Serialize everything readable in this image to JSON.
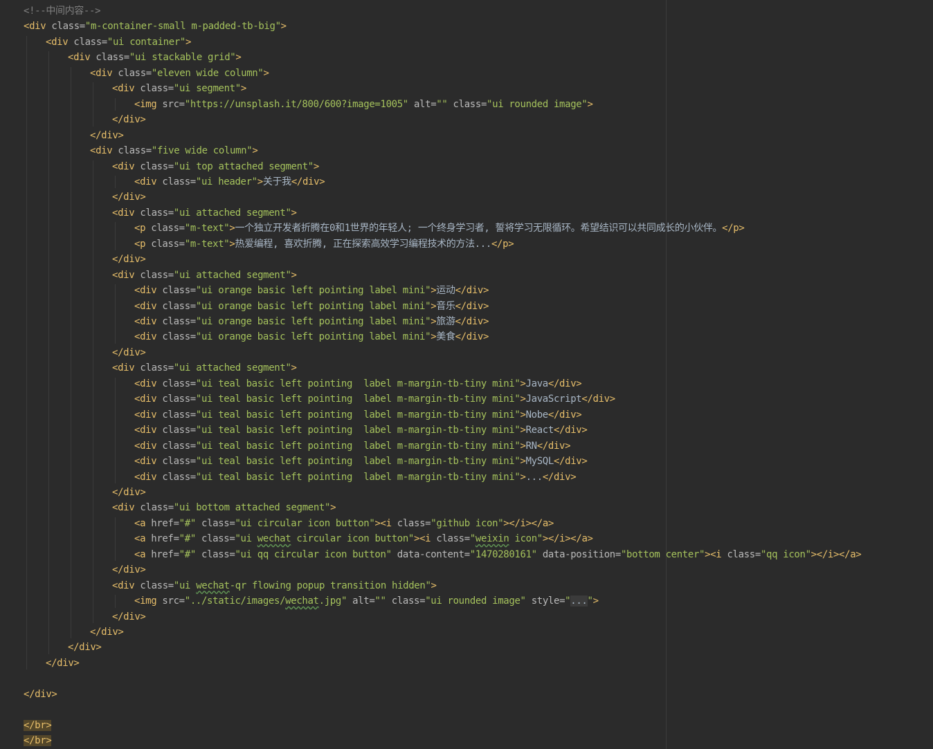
{
  "editor": {
    "language": "html",
    "colors": {
      "background": "#2b2b2b",
      "tag": "#e8bf6a",
      "attribute": "#bababa",
      "value": "#a5c25c",
      "text": "#a9b7c6",
      "comment": "#808080"
    },
    "lines": [
      {
        "indent": 0,
        "tokens": [
          {
            "c": "comment",
            "t": "<!--中间内容-->"
          }
        ]
      },
      {
        "indent": 0,
        "tokens": [
          {
            "c": "tag",
            "t": "<div "
          },
          {
            "c": "attr",
            "t": "class="
          },
          {
            "c": "val",
            "t": "\"m-container-small m-padded-tb-big\""
          },
          {
            "c": "tag",
            "t": ">"
          }
        ]
      },
      {
        "indent": 1,
        "tokens": [
          {
            "c": "tag",
            "t": "<div "
          },
          {
            "c": "attr",
            "t": "class="
          },
          {
            "c": "val",
            "t": "\"ui container\""
          },
          {
            "c": "tag",
            "t": ">"
          }
        ]
      },
      {
        "indent": 2,
        "tokens": [
          {
            "c": "tag",
            "t": "<div "
          },
          {
            "c": "attr",
            "t": "class="
          },
          {
            "c": "val",
            "t": "\"ui stackable grid\""
          },
          {
            "c": "tag",
            "t": ">"
          }
        ]
      },
      {
        "indent": 3,
        "tokens": [
          {
            "c": "tag",
            "t": "<div "
          },
          {
            "c": "attr",
            "t": "class="
          },
          {
            "c": "val",
            "t": "\"eleven wide column\""
          },
          {
            "c": "tag",
            "t": ">"
          }
        ]
      },
      {
        "indent": 4,
        "tokens": [
          {
            "c": "tag",
            "t": "<div "
          },
          {
            "c": "attr",
            "t": "class="
          },
          {
            "c": "val",
            "t": "\"ui segment\""
          },
          {
            "c": "tag",
            "t": ">"
          }
        ]
      },
      {
        "indent": 5,
        "tokens": [
          {
            "c": "tag",
            "t": "<img "
          },
          {
            "c": "attr",
            "t": "src="
          },
          {
            "c": "val",
            "t": "\"https://unsplash.it/800/600?image=1005\""
          },
          {
            "c": "attr",
            "t": " alt="
          },
          {
            "c": "val",
            "t": "\"\""
          },
          {
            "c": "attr",
            "t": " class="
          },
          {
            "c": "val",
            "t": "\"ui rounded image\""
          },
          {
            "c": "tag",
            "t": ">"
          }
        ]
      },
      {
        "indent": 4,
        "tokens": [
          {
            "c": "tag",
            "t": "</div>"
          }
        ]
      },
      {
        "indent": 3,
        "tokens": [
          {
            "c": "tag",
            "t": "</div>"
          }
        ]
      },
      {
        "indent": 3,
        "tokens": [
          {
            "c": "tag",
            "t": "<div "
          },
          {
            "c": "attr",
            "t": "class="
          },
          {
            "c": "val",
            "t": "\"five wide column\""
          },
          {
            "c": "tag",
            "t": ">"
          }
        ]
      },
      {
        "indent": 4,
        "tokens": [
          {
            "c": "tag",
            "t": "<div "
          },
          {
            "c": "attr",
            "t": "class="
          },
          {
            "c": "val",
            "t": "\"ui top attached segment\""
          },
          {
            "c": "tag",
            "t": ">"
          }
        ]
      },
      {
        "indent": 5,
        "tokens": [
          {
            "c": "tag",
            "t": "<div "
          },
          {
            "c": "attr",
            "t": "class="
          },
          {
            "c": "val",
            "t": "\"ui header\""
          },
          {
            "c": "tag",
            "t": ">"
          },
          {
            "c": "text",
            "t": "关于我"
          },
          {
            "c": "tag",
            "t": "</div>"
          }
        ]
      },
      {
        "indent": 4,
        "tokens": [
          {
            "c": "tag",
            "t": "</div>"
          }
        ]
      },
      {
        "indent": 4,
        "tokens": [
          {
            "c": "tag",
            "t": "<div "
          },
          {
            "c": "attr",
            "t": "class="
          },
          {
            "c": "val",
            "t": "\"ui attached segment\""
          },
          {
            "c": "tag",
            "t": ">"
          }
        ]
      },
      {
        "indent": 5,
        "tokens": [
          {
            "c": "tag",
            "t": "<p "
          },
          {
            "c": "attr",
            "t": "class="
          },
          {
            "c": "val",
            "t": "\"m-text\""
          },
          {
            "c": "tag",
            "t": ">"
          },
          {
            "c": "text",
            "t": "一个独立开发者折腾在0和1世界的年轻人; 一个终身学习者, 誓将学习无限循环。希望结识可以共同成长的小伙伴。"
          },
          {
            "c": "tag",
            "t": "</p>"
          }
        ]
      },
      {
        "indent": 5,
        "tokens": [
          {
            "c": "tag",
            "t": "<p "
          },
          {
            "c": "attr",
            "t": "class="
          },
          {
            "c": "val",
            "t": "\"m-text\""
          },
          {
            "c": "tag",
            "t": ">"
          },
          {
            "c": "text",
            "t": "热爱编程, 喜欢折腾, 正在探索高效学习编程技术的方法..."
          },
          {
            "c": "tag",
            "t": "</p>"
          }
        ]
      },
      {
        "indent": 4,
        "tokens": [
          {
            "c": "tag",
            "t": "</div>"
          }
        ]
      },
      {
        "indent": 4,
        "tokens": [
          {
            "c": "tag",
            "t": "<div "
          },
          {
            "c": "attr",
            "t": "class="
          },
          {
            "c": "val",
            "t": "\"ui attached segment\""
          },
          {
            "c": "tag",
            "t": ">"
          }
        ]
      },
      {
        "indent": 5,
        "tokens": [
          {
            "c": "tag",
            "t": "<div "
          },
          {
            "c": "attr",
            "t": "class="
          },
          {
            "c": "val",
            "t": "\"ui orange basic left pointing label mini\""
          },
          {
            "c": "tag",
            "t": ">"
          },
          {
            "c": "text",
            "t": "运动"
          },
          {
            "c": "tag",
            "t": "</div>"
          }
        ]
      },
      {
        "indent": 5,
        "tokens": [
          {
            "c": "tag",
            "t": "<div "
          },
          {
            "c": "attr",
            "t": "class="
          },
          {
            "c": "val",
            "t": "\"ui orange basic left pointing label mini\""
          },
          {
            "c": "tag",
            "t": ">"
          },
          {
            "c": "text",
            "t": "音乐"
          },
          {
            "c": "tag",
            "t": "</div>"
          }
        ]
      },
      {
        "indent": 5,
        "tokens": [
          {
            "c": "tag",
            "t": "<div "
          },
          {
            "c": "attr",
            "t": "class="
          },
          {
            "c": "val",
            "t": "\"ui orange basic left pointing label mini\""
          },
          {
            "c": "tag",
            "t": ">"
          },
          {
            "c": "text",
            "t": "旅游"
          },
          {
            "c": "tag",
            "t": "</div>"
          }
        ]
      },
      {
        "indent": 5,
        "tokens": [
          {
            "c": "tag",
            "t": "<div "
          },
          {
            "c": "attr",
            "t": "class="
          },
          {
            "c": "val",
            "t": "\"ui orange basic left pointing label mini\""
          },
          {
            "c": "tag",
            "t": ">"
          },
          {
            "c": "text",
            "t": "美食"
          },
          {
            "c": "tag",
            "t": "</div>"
          }
        ]
      },
      {
        "indent": 4,
        "tokens": [
          {
            "c": "tag",
            "t": "</div>"
          }
        ]
      },
      {
        "indent": 4,
        "tokens": [
          {
            "c": "tag",
            "t": "<div "
          },
          {
            "c": "attr",
            "t": "class="
          },
          {
            "c": "val",
            "t": "\"ui attached segment\""
          },
          {
            "c": "tag",
            "t": ">"
          }
        ]
      },
      {
        "indent": 5,
        "tokens": [
          {
            "c": "tag",
            "t": "<div "
          },
          {
            "c": "attr",
            "t": "class="
          },
          {
            "c": "val",
            "t": "\"ui teal basic left pointing  label m-margin-tb-tiny mini\""
          },
          {
            "c": "tag",
            "t": ">"
          },
          {
            "c": "text",
            "t": "Java"
          },
          {
            "c": "tag",
            "t": "</div>"
          }
        ]
      },
      {
        "indent": 5,
        "tokens": [
          {
            "c": "tag",
            "t": "<div "
          },
          {
            "c": "attr",
            "t": "class="
          },
          {
            "c": "val",
            "t": "\"ui teal basic left pointing  label m-margin-tb-tiny mini\""
          },
          {
            "c": "tag",
            "t": ">"
          },
          {
            "c": "text",
            "t": "JavaScript"
          },
          {
            "c": "tag",
            "t": "</div>"
          }
        ]
      },
      {
        "indent": 5,
        "tokens": [
          {
            "c": "tag",
            "t": "<div "
          },
          {
            "c": "attr",
            "t": "class="
          },
          {
            "c": "val",
            "t": "\"ui teal basic left pointing  label m-margin-tb-tiny mini\""
          },
          {
            "c": "tag",
            "t": ">"
          },
          {
            "c": "text",
            "t": "Nobe"
          },
          {
            "c": "tag",
            "t": "</div>"
          }
        ]
      },
      {
        "indent": 5,
        "tokens": [
          {
            "c": "tag",
            "t": "<div "
          },
          {
            "c": "attr",
            "t": "class="
          },
          {
            "c": "val",
            "t": "\"ui teal basic left pointing  label m-margin-tb-tiny mini\""
          },
          {
            "c": "tag",
            "t": ">"
          },
          {
            "c": "text",
            "t": "React"
          },
          {
            "c": "tag",
            "t": "</div>"
          }
        ]
      },
      {
        "indent": 5,
        "tokens": [
          {
            "c": "tag",
            "t": "<div "
          },
          {
            "c": "attr",
            "t": "class="
          },
          {
            "c": "val",
            "t": "\"ui teal basic left pointing  label m-margin-tb-tiny mini\""
          },
          {
            "c": "tag",
            "t": ">"
          },
          {
            "c": "text",
            "t": "RN"
          },
          {
            "c": "tag",
            "t": "</div>"
          }
        ]
      },
      {
        "indent": 5,
        "tokens": [
          {
            "c": "tag",
            "t": "<div "
          },
          {
            "c": "attr",
            "t": "class="
          },
          {
            "c": "val",
            "t": "\"ui teal basic left pointing  label m-margin-tb-tiny mini\""
          },
          {
            "c": "tag",
            "t": ">"
          },
          {
            "c": "text",
            "t": "MySQL"
          },
          {
            "c": "tag",
            "t": "</div>"
          }
        ]
      },
      {
        "indent": 5,
        "tokens": [
          {
            "c": "tag",
            "t": "<div "
          },
          {
            "c": "attr",
            "t": "class="
          },
          {
            "c": "val",
            "t": "\"ui teal basic left pointing  label m-margin-tb-tiny mini\""
          },
          {
            "c": "tag",
            "t": ">"
          },
          {
            "c": "text",
            "t": "..."
          },
          {
            "c": "tag",
            "t": "</div>"
          }
        ]
      },
      {
        "indent": 4,
        "tokens": [
          {
            "c": "tag",
            "t": "</div>"
          }
        ]
      },
      {
        "indent": 4,
        "tokens": [
          {
            "c": "tag",
            "t": "<div "
          },
          {
            "c": "attr",
            "t": "class="
          },
          {
            "c": "val",
            "t": "\"ui bottom attached segment\""
          },
          {
            "c": "tag",
            "t": ">"
          }
        ]
      },
      {
        "indent": 5,
        "tokens": [
          {
            "c": "tag",
            "t": "<a "
          },
          {
            "c": "attr",
            "t": "href="
          },
          {
            "c": "val",
            "t": "\"#\""
          },
          {
            "c": "attr",
            "t": " class="
          },
          {
            "c": "val",
            "t": "\"ui circular icon button\""
          },
          {
            "c": "tag",
            "t": "><i "
          },
          {
            "c": "attr",
            "t": "class="
          },
          {
            "c": "val",
            "t": "\"github icon\""
          },
          {
            "c": "tag",
            "t": "></i></a>"
          }
        ]
      },
      {
        "indent": 5,
        "tokens": [
          {
            "c": "tag",
            "t": "<a "
          },
          {
            "c": "attr",
            "t": "href="
          },
          {
            "c": "val",
            "t": "\"#\""
          },
          {
            "c": "attr",
            "t": " class="
          },
          {
            "c": "val",
            "t": "\"ui "
          },
          {
            "c": "val typo",
            "t": "wechat"
          },
          {
            "c": "val",
            "t": " circular icon button\""
          },
          {
            "c": "tag",
            "t": "><i "
          },
          {
            "c": "attr",
            "t": "class="
          },
          {
            "c": "val",
            "t": "\""
          },
          {
            "c": "val typo",
            "t": "weixin"
          },
          {
            "c": "val",
            "t": " icon\""
          },
          {
            "c": "tag",
            "t": "></i></a>"
          }
        ]
      },
      {
        "indent": 5,
        "tokens": [
          {
            "c": "tag",
            "t": "<a "
          },
          {
            "c": "attr",
            "t": "href="
          },
          {
            "c": "val",
            "t": "\"#\""
          },
          {
            "c": "attr",
            "t": " class="
          },
          {
            "c": "val",
            "t": "\"ui qq circular icon button\""
          },
          {
            "c": "attr",
            "t": " data-content="
          },
          {
            "c": "val",
            "t": "\"1470280161\""
          },
          {
            "c": "attr",
            "t": " data-position="
          },
          {
            "c": "val",
            "t": "\"bottom center\""
          },
          {
            "c": "tag",
            "t": "><i "
          },
          {
            "c": "attr",
            "t": "class="
          },
          {
            "c": "val",
            "t": "\"qq icon\""
          },
          {
            "c": "tag",
            "t": "></i></a>"
          }
        ]
      },
      {
        "indent": 4,
        "tokens": [
          {
            "c": "tag",
            "t": "</div>"
          }
        ]
      },
      {
        "indent": 4,
        "tokens": [
          {
            "c": "tag",
            "t": "<div "
          },
          {
            "c": "attr",
            "t": "class="
          },
          {
            "c": "val",
            "t": "\"ui "
          },
          {
            "c": "val typo",
            "t": "wechat"
          },
          {
            "c": "val",
            "t": "-qr flowing popup transition hidden\""
          },
          {
            "c": "tag",
            "t": ">"
          }
        ]
      },
      {
        "indent": 5,
        "tokens": [
          {
            "c": "tag",
            "t": "<img "
          },
          {
            "c": "attr",
            "t": "src="
          },
          {
            "c": "val",
            "t": "\"../static/images/"
          },
          {
            "c": "val typo",
            "t": "wechat"
          },
          {
            "c": "val",
            "t": ".jpg\""
          },
          {
            "c": "attr",
            "t": " alt="
          },
          {
            "c": "val",
            "t": "\"\""
          },
          {
            "c": "attr",
            "t": " class="
          },
          {
            "c": "val",
            "t": "\"ui rounded image\""
          },
          {
            "c": "attr",
            "t": " style="
          },
          {
            "c": "val",
            "t": "\""
          },
          {
            "c": "fold",
            "t": "..."
          },
          {
            "c": "val",
            "t": "\""
          },
          {
            "c": "tag",
            "t": ">"
          }
        ]
      },
      {
        "indent": 4,
        "tokens": [
          {
            "c": "tag",
            "t": "</div>"
          }
        ]
      },
      {
        "indent": 3,
        "tokens": [
          {
            "c": "tag",
            "t": "</div>"
          }
        ]
      },
      {
        "indent": 2,
        "tokens": [
          {
            "c": "tag",
            "t": "</div>"
          }
        ]
      },
      {
        "indent": 1,
        "tokens": [
          {
            "c": "tag",
            "t": "</div>"
          }
        ]
      },
      {
        "indent": 0,
        "tokens": []
      },
      {
        "indent": 0,
        "tokens": [
          {
            "c": "tag",
            "t": "</div>"
          }
        ]
      },
      {
        "indent": 0,
        "tokens": []
      },
      {
        "indent": 0,
        "tokens": [
          {
            "c": "tag hl",
            "t": "</br>"
          }
        ]
      },
      {
        "indent": 0,
        "tokens": [
          {
            "c": "tag hl",
            "t": "</br>"
          }
        ]
      }
    ]
  }
}
